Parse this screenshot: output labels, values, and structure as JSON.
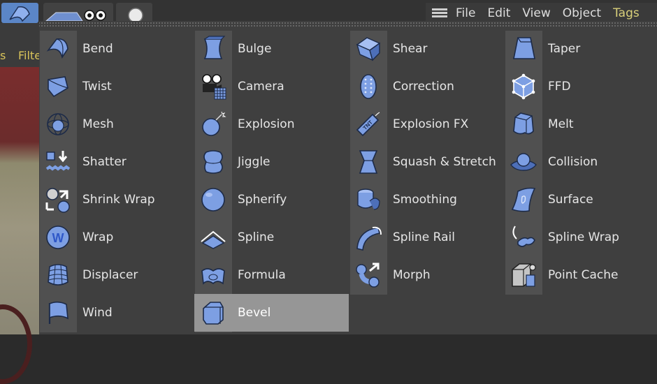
{
  "menubar": {
    "items": [
      "File",
      "Edit",
      "View",
      "Object",
      "Tags"
    ]
  },
  "side": {
    "fragment_1": "s",
    "fragment_2": "Filte"
  },
  "deformers": [
    [
      {
        "label": "Bend",
        "icon": "bend-icon"
      },
      {
        "label": "Twist",
        "icon": "twist-icon"
      },
      {
        "label": "Mesh",
        "icon": "mesh-icon"
      },
      {
        "label": "Shatter",
        "icon": "shatter-icon"
      },
      {
        "label": "Shrink Wrap",
        "icon": "shrink-wrap-icon"
      },
      {
        "label": "Wrap",
        "icon": "wrap-icon"
      },
      {
        "label": "Displacer",
        "icon": "displacer-icon"
      },
      {
        "label": "Wind",
        "icon": "wind-icon"
      }
    ],
    [
      {
        "label": "Bulge",
        "icon": "bulge-icon"
      },
      {
        "label": "Camera",
        "icon": "camera-icon"
      },
      {
        "label": "Explosion",
        "icon": "explosion-icon"
      },
      {
        "label": "Jiggle",
        "icon": "jiggle-icon"
      },
      {
        "label": "Spherify",
        "icon": "spherify-icon"
      },
      {
        "label": "Spline",
        "icon": "spline-icon"
      },
      {
        "label": "Formula",
        "icon": "formula-icon"
      },
      {
        "label": "Bevel",
        "icon": "bevel-icon",
        "selected": true
      }
    ],
    [
      {
        "label": "Shear",
        "icon": "shear-icon"
      },
      {
        "label": "Correction",
        "icon": "correction-icon"
      },
      {
        "label": "Explosion FX",
        "icon": "explosion-fx-icon"
      },
      {
        "label": "Squash & Stretch",
        "icon": "squash-stretch-icon"
      },
      {
        "label": "Smoothing",
        "icon": "smoothing-icon"
      },
      {
        "label": "Spline Rail",
        "icon": "spline-rail-icon"
      },
      {
        "label": "Morph",
        "icon": "morph-icon"
      }
    ],
    [
      {
        "label": "Taper",
        "icon": "taper-icon"
      },
      {
        "label": "FFD",
        "icon": "ffd-icon"
      },
      {
        "label": "Melt",
        "icon": "melt-icon"
      },
      {
        "label": "Collision",
        "icon": "collision-icon"
      },
      {
        "label": "Surface",
        "icon": "surface-icon"
      },
      {
        "label": "Spline Wrap",
        "icon": "spline-wrap-icon"
      },
      {
        "label": "Point Cache",
        "icon": "point-cache-icon"
      }
    ]
  ],
  "colors": {
    "icon_fill": "#7d9fe3",
    "icon_dark": "#4d6fb8",
    "selected_bg": "#969696",
    "accent_menu": "#d9d07a"
  }
}
